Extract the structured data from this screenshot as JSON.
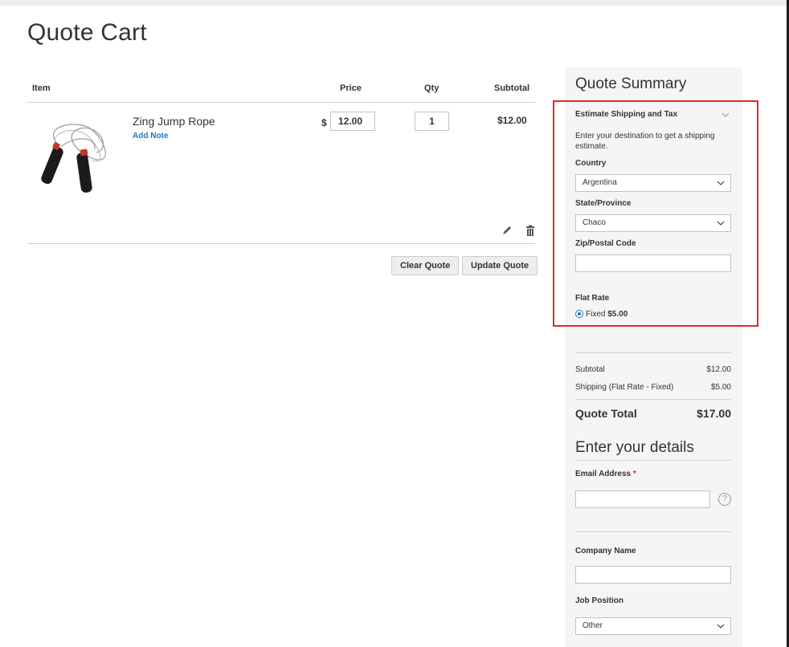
{
  "page": {
    "title": "Quote Cart"
  },
  "cart": {
    "headers": {
      "item": "Item",
      "price": "Price",
      "qty": "Qty",
      "subtotal": "Subtotal"
    },
    "items": [
      {
        "name": "Zing Jump Rope",
        "add_note": "Add Note",
        "currency": "$",
        "price": "12.00",
        "qty": "1",
        "subtotal": "$12.00"
      }
    ],
    "buttons": {
      "clear": "Clear Quote",
      "update": "Update Quote"
    }
  },
  "summary": {
    "title": "Quote Summary",
    "estimate": {
      "title": "Estimate Shipping and Tax",
      "description": "Enter your destination to get a shipping estimate.",
      "country_label": "Country",
      "country_value": "Argentina",
      "state_label": "State/Province",
      "state_value": "Chaco",
      "zip_label": "Zip/Postal Code",
      "zip_value": "",
      "method_title": "Flat Rate",
      "method_option": "Fixed",
      "method_price": "$5.00"
    },
    "totals": {
      "subtotal_label": "Subtotal",
      "subtotal_value": "$12.00",
      "shipping_label": "Shipping (Flat Rate - Fixed)",
      "shipping_value": "$5.00",
      "grand_label": "Quote Total",
      "grand_value": "$17.00"
    }
  },
  "details": {
    "title": "Enter your details",
    "email_label": "Email Address",
    "required_mark": "*",
    "email_value": "",
    "help_glyph": "?",
    "company_label": "Company Name",
    "company_value": "",
    "job_label": "Job Position",
    "job_value": "Other"
  },
  "colors": {
    "link": "#1979c3",
    "highlight": "#e02b27",
    "sidebar_bg": "#f5f5f5"
  }
}
